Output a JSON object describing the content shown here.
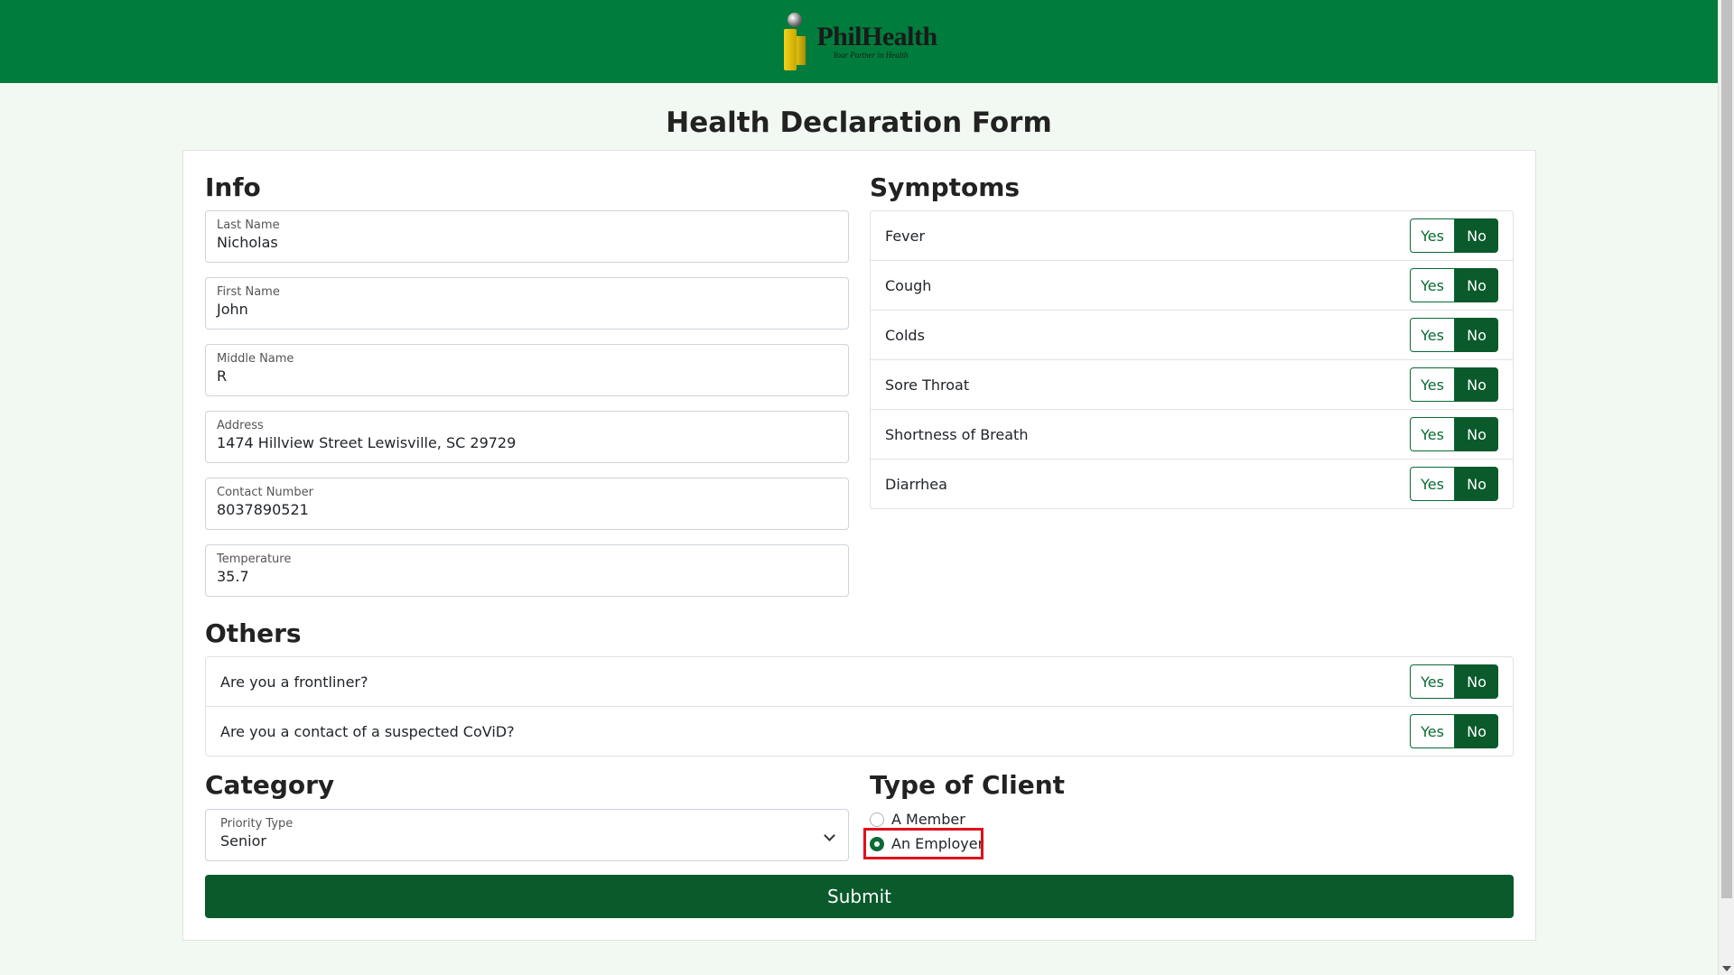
{
  "header": {
    "logo_name": "PhilHealth",
    "logo_tagline": "Your Partner in Health"
  },
  "page_title": "Health Declaration Form",
  "info": {
    "title": "Info",
    "fields": [
      {
        "label": "Last Name",
        "value": "Nicholas"
      },
      {
        "label": "First Name",
        "value": "John"
      },
      {
        "label": "Middle Name",
        "value": "R"
      },
      {
        "label": "Address",
        "value": "1474 Hillview Street Lewisville, SC 29729"
      },
      {
        "label": "Contact Number",
        "value": "8037890521"
      },
      {
        "label": "Temperature",
        "value": "35.7"
      }
    ]
  },
  "symptoms": {
    "title": "Symptoms",
    "yes_label": "Yes",
    "no_label": "No",
    "items": [
      {
        "label": "Fever",
        "selected": "No"
      },
      {
        "label": "Cough",
        "selected": "No"
      },
      {
        "label": "Colds",
        "selected": "No"
      },
      {
        "label": "Sore Throat",
        "selected": "No"
      },
      {
        "label": "Shortness of Breath",
        "selected": "No"
      },
      {
        "label": "Diarrhea",
        "selected": "No"
      }
    ]
  },
  "others": {
    "title": "Others",
    "items": [
      {
        "label": "Are you a frontliner?",
        "selected": "No"
      },
      {
        "label": "Are you a contact of a suspected CoViD?",
        "selected": "No"
      }
    ]
  },
  "category": {
    "title": "Category",
    "select_label": "Priority Type",
    "select_value": "Senior"
  },
  "client_type": {
    "title": "Type of Client",
    "options": [
      {
        "label": "A Member",
        "checked": false
      },
      {
        "label": "An Employer",
        "checked": true
      }
    ]
  },
  "submit_label": "Submit",
  "colors": {
    "brand_green": "#007c3d",
    "button_green": "#0a5a2b",
    "highlight_red": "#e0101a"
  }
}
